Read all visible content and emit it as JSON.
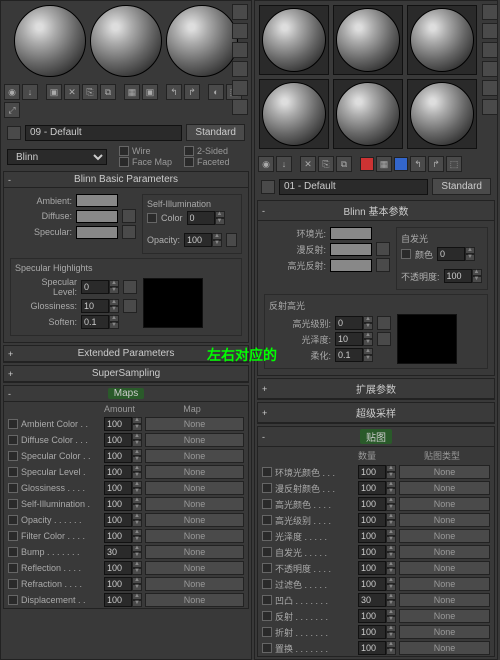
{
  "annotation": "左右对应的",
  "left": {
    "material_name": "09 - Default",
    "type_button": "Standard",
    "shader": "Blinn",
    "shader_opts": {
      "wire": "Wire",
      "two_sided": "2-Sided",
      "face_map": "Face Map",
      "faceted": "Faceted"
    },
    "rollup_basic": "Blinn Basic Parameters",
    "self_illum": "Self-Illumination",
    "ambient": "Ambient:",
    "diffuse": "Diffuse:",
    "specular": "Specular:",
    "color": "Color",
    "color_val": "0",
    "opacity": "Opacity:",
    "opacity_val": "100",
    "spec_highlights": "Specular Highlights",
    "spec_level": "Specular Level:",
    "spec_level_val": "0",
    "glossiness": "Glossiness:",
    "glossiness_val": "10",
    "soften": "Soften:",
    "soften_val": "0.1",
    "rollup_ext": "Extended Parameters",
    "rollup_ss": "SuperSampling",
    "rollup_maps": "Maps",
    "maps_h_amount": "Amount",
    "maps_h_map": "Map",
    "maps": [
      {
        "name": "Ambient Color . .",
        "amt": "100",
        "slot": "None"
      },
      {
        "name": "Diffuse Color . . .",
        "amt": "100",
        "slot": "None"
      },
      {
        "name": "Specular Color . .",
        "amt": "100",
        "slot": "None"
      },
      {
        "name": "Specular Level .",
        "amt": "100",
        "slot": "None"
      },
      {
        "name": "Glossiness . . . .",
        "amt": "100",
        "slot": "None"
      },
      {
        "name": "Self-Illumination .",
        "amt": "100",
        "slot": "None"
      },
      {
        "name": "Opacity . . . . . .",
        "amt": "100",
        "slot": "None"
      },
      {
        "name": "Filter Color . . . .",
        "amt": "100",
        "slot": "None"
      },
      {
        "name": "Bump . . . . . . .",
        "amt": "30",
        "slot": "None"
      },
      {
        "name": "Reflection . . . .",
        "amt": "100",
        "slot": "None"
      },
      {
        "name": "Refraction . . . .",
        "amt": "100",
        "slot": "None"
      },
      {
        "name": "Displacement . .",
        "amt": "100",
        "slot": "None"
      }
    ]
  },
  "right": {
    "material_name": "01 - Default",
    "type_button": "Standard",
    "shader": "Blinn",
    "rollup_basic": "Blinn 基本参数",
    "self_illum": "自发光",
    "ambient": "环境光:",
    "diffuse": "漫反射:",
    "specular": "高光反射:",
    "color": "颜色",
    "color_val": "0",
    "opacity": "不透明度:",
    "opacity_val": "100",
    "spec_highlights": "反射高光",
    "spec_level": "高光级别:",
    "spec_level_val": "0",
    "glossiness": "光泽度:",
    "glossiness_val": "10",
    "soften": "柔化:",
    "soften_val": "0.1",
    "rollup_ext": "扩展参数",
    "rollup_ss": "超级采样",
    "rollup_maps": "贴图",
    "maps_h_amount": "数量",
    "maps_h_map": "贴图类型",
    "maps": [
      {
        "name": "环境光颜色 . . .",
        "amt": "100",
        "slot": "None"
      },
      {
        "name": "漫反射颜色 . . .",
        "amt": "100",
        "slot": "None"
      },
      {
        "name": "高光颜色 . . . .",
        "amt": "100",
        "slot": "None"
      },
      {
        "name": "高光级别 . . . .",
        "amt": "100",
        "slot": "None"
      },
      {
        "name": "光泽度 . . . . .",
        "amt": "100",
        "slot": "None"
      },
      {
        "name": "自发光 . . . . .",
        "amt": "100",
        "slot": "None"
      },
      {
        "name": "不透明度 . . . .",
        "amt": "100",
        "slot": "None"
      },
      {
        "name": "过滤色 . . . . .",
        "amt": "100",
        "slot": "None"
      },
      {
        "name": "凹凸 . . . . . . .",
        "amt": "30",
        "slot": "None"
      },
      {
        "name": "反射 . . . . . . .",
        "amt": "100",
        "slot": "None"
      },
      {
        "name": "折射 . . . . . . .",
        "amt": "100",
        "slot": "None"
      },
      {
        "name": "置换 . . . . . . .",
        "amt": "100",
        "slot": "None"
      }
    ]
  }
}
